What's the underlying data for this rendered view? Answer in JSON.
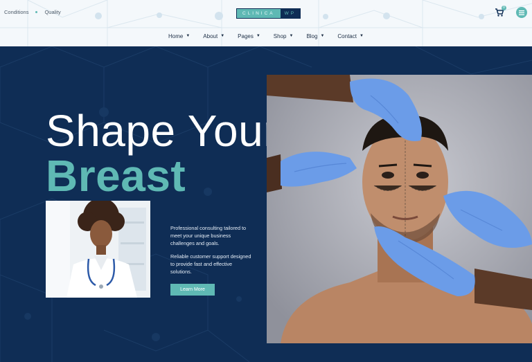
{
  "topbar": {
    "conditions": "Conditions",
    "quality": "Quality"
  },
  "logo": {
    "part1": "CLINICA",
    "part2": "WP"
  },
  "cart": {
    "count": "0"
  },
  "nav": {
    "items": [
      {
        "label": "Home"
      },
      {
        "label": "About"
      },
      {
        "label": "Pages"
      },
      {
        "label": "Shop"
      },
      {
        "label": "Blog"
      },
      {
        "label": "Contact"
      }
    ]
  },
  "hero": {
    "title_line1": "Shape Your",
    "title_line2": "Breast",
    "paragraph1": "Professional consulting tailored to meet your unique business challenges and goals.",
    "paragraph2": "Reliable customer support designed to provide fast and effective solutions.",
    "button_label": "Learn More"
  },
  "colors": {
    "navy": "#0f2d55",
    "teal": "#5fb9b4",
    "header_bg": "#f4f8fb",
    "glove_blue": "#6b9ce8"
  },
  "icons": [
    "cart-icon",
    "menu-icon",
    "chevron-down-icon"
  ]
}
